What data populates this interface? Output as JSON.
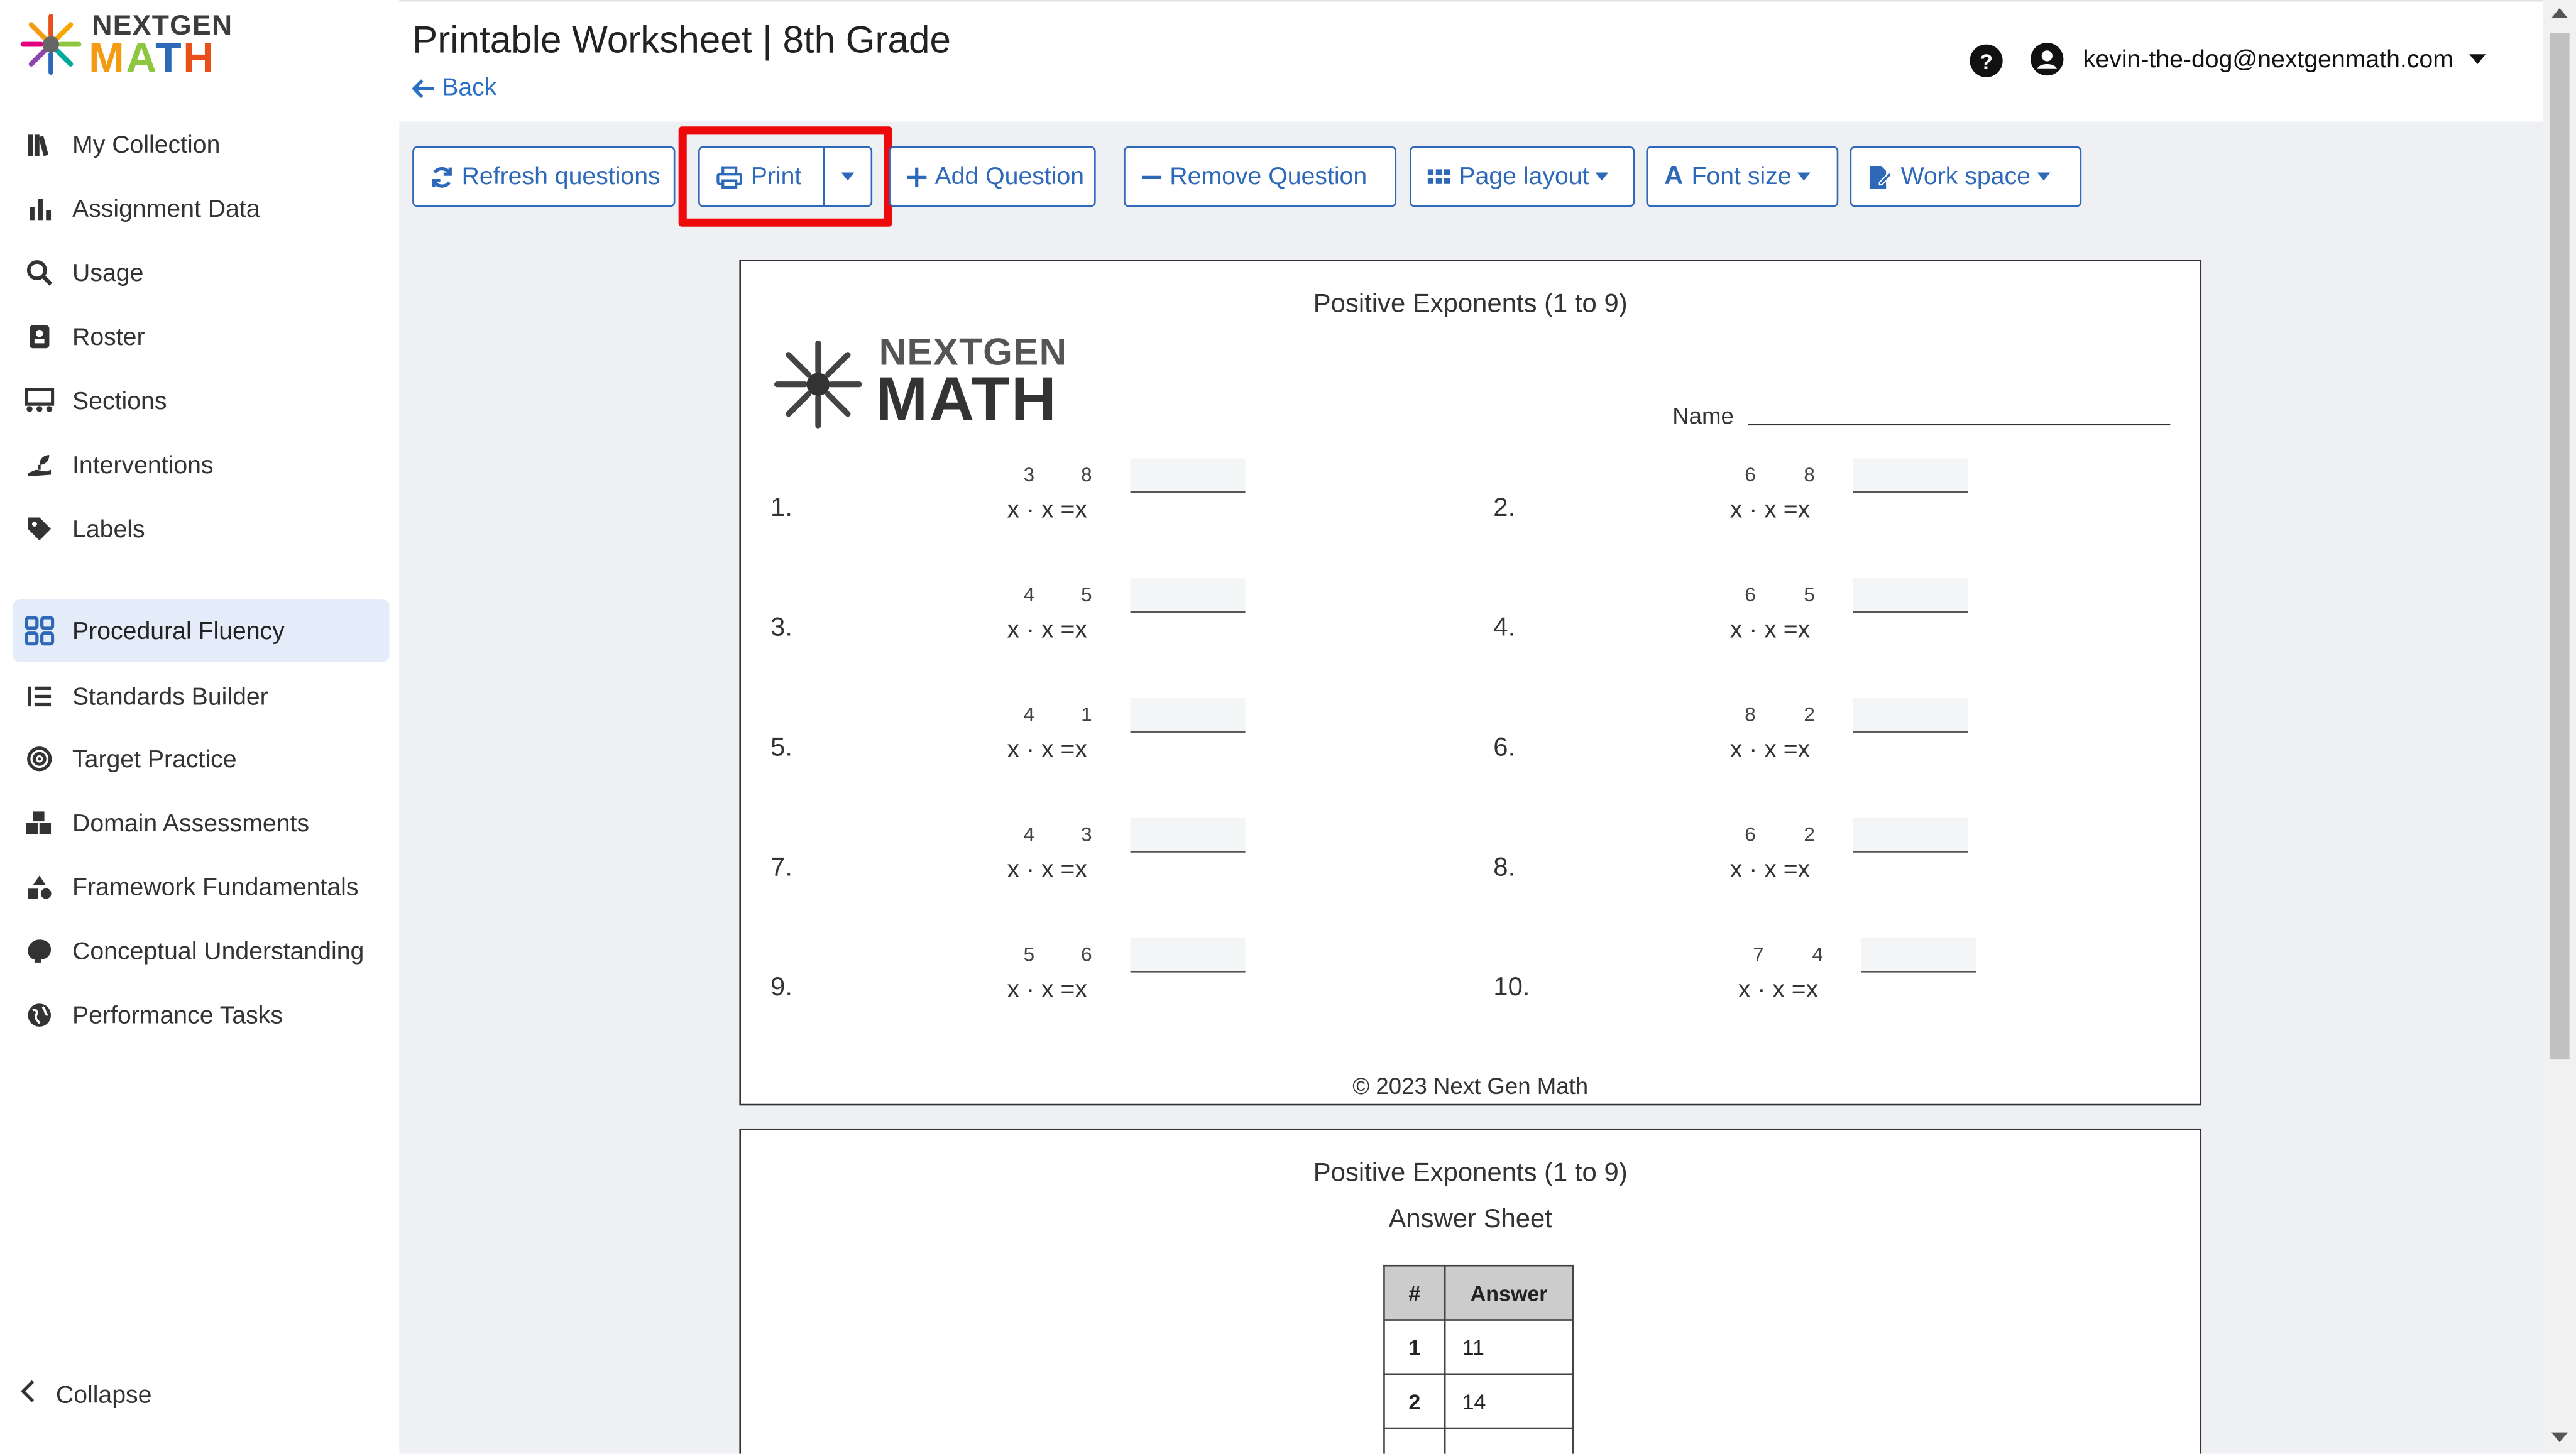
{
  "logo": {
    "top": "NEXTGEN",
    "bottom": "MATH"
  },
  "sidebar": {
    "items": [
      {
        "label": "My Collection",
        "icon": "books-icon"
      },
      {
        "label": "Assignment Data",
        "icon": "bar-chart-icon"
      },
      {
        "label": "Usage",
        "icon": "magnify-chart-icon"
      },
      {
        "label": "Roster",
        "icon": "id-card-icon"
      },
      {
        "label": "Sections",
        "icon": "sections-icon"
      },
      {
        "label": "Interventions",
        "icon": "hand-seedling-icon"
      },
      {
        "label": "Labels",
        "icon": "tag-icon"
      },
      {
        "label": "Procedural Fluency",
        "icon": "grid-icon",
        "active": true
      },
      {
        "label": "Standards Builder",
        "icon": "list-icon"
      },
      {
        "label": "Target Practice",
        "icon": "target-icon"
      },
      {
        "label": "Domain Assessments",
        "icon": "cubes-icon"
      },
      {
        "label": "Framework Fundamentals",
        "icon": "shapes-icon"
      },
      {
        "label": "Conceptual Understanding",
        "icon": "brain-icon"
      },
      {
        "label": "Performance Tasks",
        "icon": "globe-icon"
      }
    ],
    "collapse_label": "Collapse"
  },
  "header": {
    "title": "Printable Worksheet | 8th Grade",
    "back_label": "Back",
    "account_email": "kevin-the-dog@nextgenmath.com"
  },
  "toolbar": {
    "refresh": "Refresh questions",
    "print": "Print",
    "add_question": "Add Question",
    "remove_question": "Remove Question",
    "page_layout": "Page layout",
    "font_size": "Font size",
    "work_space": "Work space"
  },
  "worksheet": {
    "title": "Positive Exponents (1 to 9)",
    "name_label": "Name",
    "copyright": "© 2023 Next Gen Math",
    "problems": [
      {
        "num": "1.",
        "a": "3",
        "b": "8"
      },
      {
        "num": "2.",
        "a": "6",
        "b": "8"
      },
      {
        "num": "3.",
        "a": "4",
        "b": "5"
      },
      {
        "num": "4.",
        "a": "6",
        "b": "5"
      },
      {
        "num": "5.",
        "a": "4",
        "b": "1"
      },
      {
        "num": "6.",
        "a": "8",
        "b": "2"
      },
      {
        "num": "7.",
        "a": "4",
        "b": "3"
      },
      {
        "num": "8.",
        "a": "6",
        "b": "2"
      },
      {
        "num": "9.",
        "a": "5",
        "b": "6"
      },
      {
        "num": "10.",
        "a": "7",
        "b": "4"
      }
    ],
    "expr_text": "x · x =x"
  },
  "answer_sheet": {
    "title": "Positive Exponents (1 to 9)",
    "subtitle": "Answer Sheet",
    "col_num": "#",
    "col_answer": "Answer",
    "rows": [
      {
        "num": "1",
        "answer": "11"
      },
      {
        "num": "2",
        "answer": "14"
      }
    ]
  },
  "colors": {
    "accent": "#2e68b8",
    "highlight": "#ee0a0a",
    "active_bg": "#e3ecf8"
  }
}
